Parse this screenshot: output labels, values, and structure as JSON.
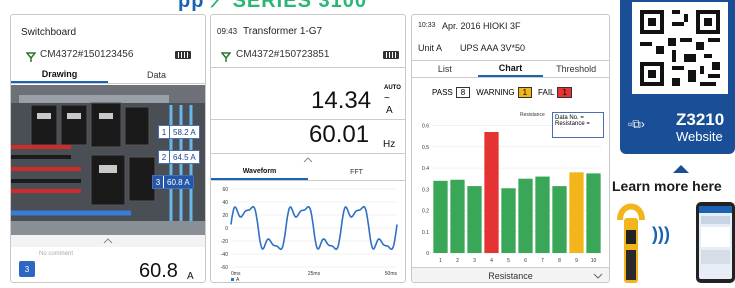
{
  "banner": {
    "brand_fragment": "pp",
    "logo_text": "SERIES 3100"
  },
  "colors": {
    "accent_blue": "#1a63b3",
    "chart_green": "#3aa658",
    "chart_red": "#e53333",
    "chart_yellow": "#f2b51c",
    "warning": "#f2b51c",
    "fail": "#e53333",
    "panel_blue": "#1a4f97"
  },
  "screen1": {
    "title": "Switchboard",
    "device": "CM4372#150123456",
    "tabs": [
      "Drawing",
      "Data"
    ],
    "active_tab": 0,
    "tags": [
      {
        "num": "1",
        "value": "58.2 A"
      },
      {
        "num": "2",
        "value": "64.5 A"
      },
      {
        "num": "3",
        "value": "60.8 A"
      }
    ],
    "comment_placeholder": "No comment",
    "badge": "3",
    "reading": "60.8",
    "reading_unit": "A"
  },
  "screen2": {
    "time": "09:43",
    "title": "Transformer 1-G7",
    "device": "CM4372#150723851",
    "reading1": "14.34",
    "reading1_mode": "AUTO",
    "reading1_unit": "A",
    "reading2": "60.01",
    "reading2_unit": "Hz",
    "tabs": [
      "Waveform",
      "FFT"
    ],
    "active_tab": 0,
    "waveform_yticks": [
      "60",
      "40",
      "20",
      "0",
      "-20",
      "-40",
      "-60"
    ],
    "waveform_xticks": [
      "0ms",
      "25ms",
      "50ms"
    ],
    "legend": "A"
  },
  "screen3": {
    "time": "10:33",
    "title": "Apr. 2016 HIOKI 3F",
    "unit_label": "Unit",
    "unit_value": "A",
    "unit_name": "UPS AAA 3V*50",
    "tabs": [
      "List",
      "Chart",
      "Threshold"
    ],
    "active_tab": 1,
    "pass_label": "PASS",
    "pass_count": "8",
    "warning_label": "WARNING",
    "warning_count": "1",
    "fail_label": "FAIL",
    "fail_count": "1",
    "tooltip_title": "Resistance",
    "tooltip_rows": [
      "Data No.   =",
      "Resistance ="
    ],
    "footer": "Resistance"
  },
  "chart_data": {
    "type": "bar",
    "categories": [
      "1",
      "2",
      "3",
      "4",
      "5",
      "6",
      "7",
      "8",
      "9",
      "10"
    ],
    "values": [
      0.34,
      0.345,
      0.315,
      0.57,
      0.305,
      0.35,
      0.36,
      0.315,
      0.38,
      0.375
    ],
    "status": [
      "pass",
      "pass",
      "pass",
      "fail",
      "pass",
      "pass",
      "pass",
      "pass",
      "warning",
      "pass"
    ],
    "ylim": [
      0,
      0.65
    ],
    "yticks": [
      "0.6",
      "0.5",
      "0.4",
      "0.3",
      "0.2",
      "0.1",
      "0"
    ],
    "grid": true
  },
  "sidebar": {
    "code": "Z3210",
    "link_label": "Website",
    "learn_more": "Learn more here"
  }
}
